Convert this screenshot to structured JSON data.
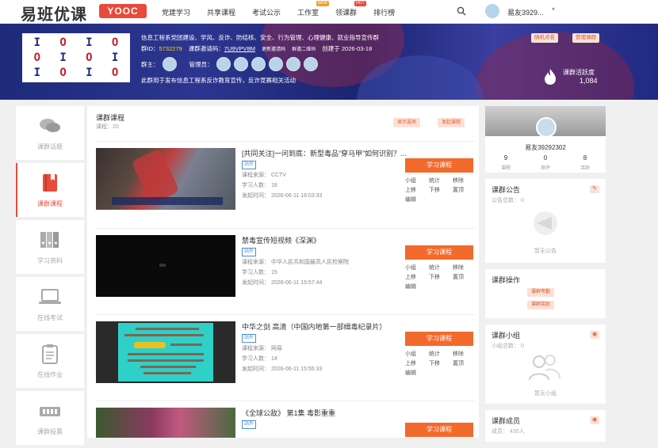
{
  "header": {
    "logo_cn": "易班优课",
    "logo_en": "YOOC",
    "nav": [
      {
        "label": "党建学习"
      },
      {
        "label": "共享课程"
      },
      {
        "label": "考试公示"
      },
      {
        "label": "工作室",
        "badge": "NEW"
      },
      {
        "label": "领课群",
        "badge": "HOT"
      },
      {
        "label": "排行榜"
      }
    ],
    "username": "易友3929...",
    "icons": {
      "search": "search-icon",
      "chevron": "chevron-down-icon"
    }
  },
  "banner": {
    "group_name": "信息工程系党团建设、学风、反诈、防结核、安全、行为管理、心理健康、就业指导宣传群",
    "group_id_label": "群ID：",
    "group_id": "5732279",
    "invite_label": "课群邀请码：",
    "invite_code": "7U9VPV8M",
    "change_invite": "更新邀请码",
    "qr_code": "群邀二维码",
    "created_label": "创建于",
    "created_date": "2026-03-18",
    "owner_label": "群主：",
    "admin_label": "管理员：",
    "description": "此群用于发布信息工程系反诈教育宣传，反诈竞赛相关活动",
    "btn_change_group": "随机点名",
    "btn_manage": "管理课群",
    "activity_label": "课群活跃度",
    "activity_value": "1,084"
  },
  "leftnav": [
    {
      "label": "课群话题",
      "icon": "chat-bubbles-icon",
      "active": false
    },
    {
      "label": "课群课程",
      "icon": "book-icon",
      "active": true
    },
    {
      "label": "学习资料",
      "icon": "binders-icon",
      "active": false
    },
    {
      "label": "在线考试",
      "icon": "laptop-icon",
      "active": false
    },
    {
      "label": "在线作业",
      "icon": "clipboard-icon",
      "active": false
    },
    {
      "label": "课群投票",
      "icon": "ballot-icon",
      "active": false
    }
  ],
  "main": {
    "title": "课群课程",
    "count_label": "课程：",
    "count": "20",
    "btn_show_all": "显示选项",
    "btn_publish": "发起课程",
    "study_button": "学习课程",
    "ops": [
      "小组",
      "统计",
      "移除",
      "上移",
      "下移",
      "置顶",
      "编辑"
    ],
    "courses": [
      {
        "title": "[共同关注]一问到底：新型毒品“穿马甲”如何识别？...",
        "tag": "站外",
        "source": "课程来源：  CCTV",
        "learners": "学习人数：  18",
        "date": "发起时间：  2026-06-11 16:03:33"
      },
      {
        "title": "禁毒宣传短视频《深渊》",
        "tag": "站外",
        "source": "课程来源：  中华人民共和国最高人民检察院",
        "learners": "学习人数：  15",
        "date": "发起时间：  2026-06-11 15:57:44"
      },
      {
        "title": "中华之剑 高清（中国内地第一部缉毒纪录片）",
        "tag": "站外",
        "source": "课程来源：  网易",
        "learners": "学习人数：  14",
        "date": "发起时间：  2026-06-11 15:55:33"
      },
      {
        "title": "《全球公敌》 第1集 毒影重重",
        "tag": "站外",
        "source": "",
        "learners": "",
        "date": ""
      }
    ]
  },
  "right": {
    "profile": {
      "name": "易友39292302",
      "stats": [
        {
          "value": "9",
          "label": "课程"
        },
        {
          "value": "0",
          "label": "测评"
        },
        {
          "value": "8",
          "label": "活跃"
        }
      ]
    },
    "notice": {
      "title": "课群公告",
      "sub": "公告总数：  0",
      "empty": "暂无公告"
    },
    "ops": {
      "title": "课群操作",
      "buttons": [
        "课群考勤",
        "课群奖励"
      ]
    },
    "groups": {
      "title": "课群小组",
      "sub": "小组总数：  0",
      "empty": "暂无小组"
    },
    "members": {
      "title": "课群成员",
      "sub": "成员：  430人"
    }
  }
}
